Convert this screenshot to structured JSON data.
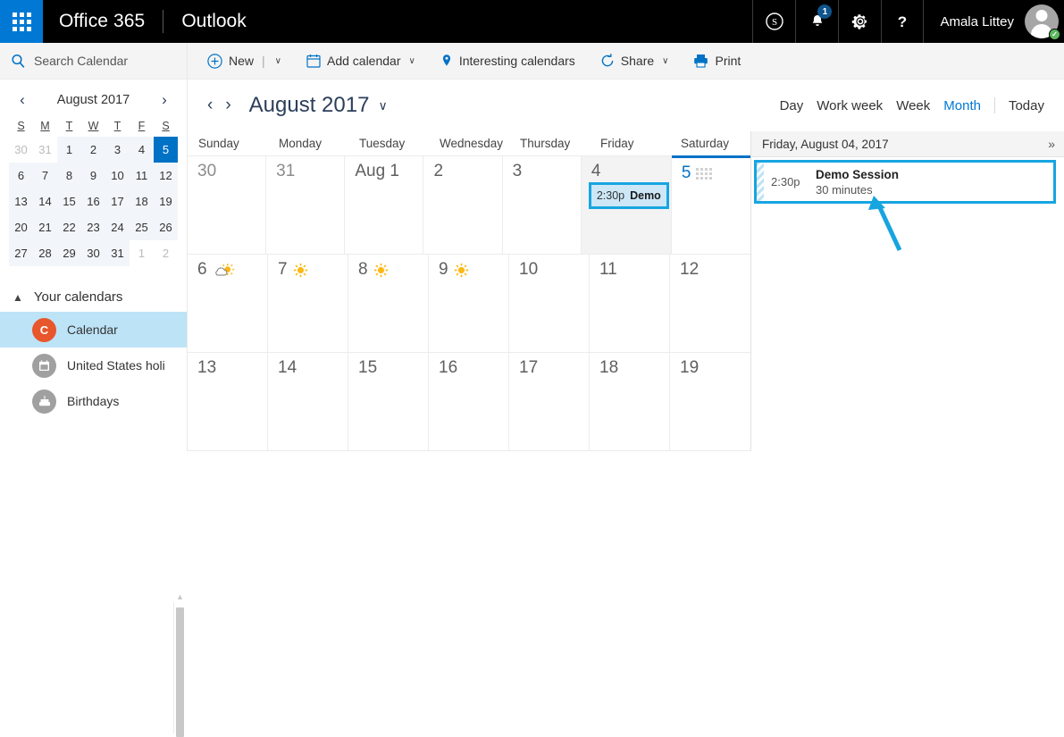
{
  "suite": {
    "waffle_name": "app-launcher",
    "brand": "Office 365",
    "app": "Outlook",
    "skype_icon": "skype-icon",
    "notifications_icon": "bell-icon",
    "notifications_count": "1",
    "settings_icon": "gear-icon",
    "help_icon": "help-icon",
    "user_name": "Amala Littey",
    "presence_icon": "available-check-icon"
  },
  "toolbar": {
    "new_label": "New",
    "new_split": "|",
    "add_calendar_label": "Add calendar",
    "interesting_label": "Interesting calendars",
    "share_label": "Share",
    "print_label": "Print",
    "caret": "∨"
  },
  "search": {
    "placeholder": "Search Calendar",
    "value": "",
    "icon": "search-icon"
  },
  "minicalendar": {
    "title": "August 2017",
    "prev": "‹",
    "next": "›",
    "dow": [
      "S",
      "M",
      "T",
      "W",
      "T",
      "F",
      "S"
    ],
    "weeks": [
      [
        {
          "d": "30",
          "m": "other"
        },
        {
          "d": "31",
          "m": "other"
        },
        {
          "d": "1",
          "m": "cur"
        },
        {
          "d": "2",
          "m": "cur"
        },
        {
          "d": "3",
          "m": "cur"
        },
        {
          "d": "4",
          "m": "cur"
        },
        {
          "d": "5",
          "m": "today"
        }
      ],
      [
        {
          "d": "6",
          "m": "cur"
        },
        {
          "d": "7",
          "m": "cur"
        },
        {
          "d": "8",
          "m": "cur"
        },
        {
          "d": "9",
          "m": "cur"
        },
        {
          "d": "10",
          "m": "cur"
        },
        {
          "d": "11",
          "m": "cur"
        },
        {
          "d": "12",
          "m": "cur"
        }
      ],
      [
        {
          "d": "13",
          "m": "cur"
        },
        {
          "d": "14",
          "m": "cur"
        },
        {
          "d": "15",
          "m": "cur"
        },
        {
          "d": "16",
          "m": "cur"
        },
        {
          "d": "17",
          "m": "cur"
        },
        {
          "d": "18",
          "m": "cur"
        },
        {
          "d": "19",
          "m": "cur"
        }
      ],
      [
        {
          "d": "20",
          "m": "cur"
        },
        {
          "d": "21",
          "m": "cur"
        },
        {
          "d": "22",
          "m": "cur"
        },
        {
          "d": "23",
          "m": "cur"
        },
        {
          "d": "24",
          "m": "cur"
        },
        {
          "d": "25",
          "m": "cur"
        },
        {
          "d": "26",
          "m": "cur"
        }
      ],
      [
        {
          "d": "27",
          "m": "cur"
        },
        {
          "d": "28",
          "m": "cur"
        },
        {
          "d": "29",
          "m": "cur"
        },
        {
          "d": "30",
          "m": "cur"
        },
        {
          "d": "31",
          "m": "cur"
        },
        {
          "d": "1",
          "m": "other"
        },
        {
          "d": "2",
          "m": "other"
        }
      ]
    ]
  },
  "calendars": {
    "section_label": "Your calendars",
    "collapse_icon": "chevron-up-icon",
    "items": [
      {
        "label": "Calendar",
        "glyph": "C",
        "color": "#e8562b",
        "icon": "calendar-letter-icon",
        "selected": true
      },
      {
        "label": "United States holi",
        "glyph": "",
        "color": "#a0a0a0",
        "icon": "holiday-calendar-icon",
        "selected": false
      },
      {
        "label": "Birthdays",
        "glyph": "",
        "color": "#a0a0a0",
        "icon": "birthday-cake-icon",
        "selected": false
      }
    ]
  },
  "calnav": {
    "prev": "‹",
    "next": "›",
    "title": "August 2017",
    "caret": "∨",
    "views": [
      {
        "label": "Day",
        "active": false
      },
      {
        "label": "Work week",
        "active": false
      },
      {
        "label": "Week",
        "active": false
      },
      {
        "label": "Month",
        "active": true
      }
    ],
    "today_label": "Today"
  },
  "grid": {
    "dow": [
      "Sunday",
      "Monday",
      "Tuesday",
      "Wednesday",
      "Thursday",
      "Friday",
      "Saturday"
    ],
    "weeks": [
      [
        {
          "num": "30",
          "type": "other"
        },
        {
          "num": "31",
          "type": "other"
        },
        {
          "num": "Aug 1",
          "type": "cur"
        },
        {
          "num": "2",
          "type": "cur"
        },
        {
          "num": "3",
          "type": "cur"
        },
        {
          "num": "4",
          "type": "cur",
          "shaded": true,
          "events": [
            {
              "time": "2:30p",
              "title": "Demo",
              "selected": true
            }
          ]
        },
        {
          "num": "5",
          "type": "today",
          "weather": "dots"
        }
      ],
      [
        {
          "num": "6",
          "type": "cur",
          "weather": "partly-cloudy"
        },
        {
          "num": "7",
          "type": "cur",
          "weather": "sunny"
        },
        {
          "num": "8",
          "type": "cur",
          "weather": "sunny"
        },
        {
          "num": "9",
          "type": "cur",
          "weather": "sunny"
        },
        {
          "num": "10",
          "type": "cur"
        },
        {
          "num": "11",
          "type": "cur"
        },
        {
          "num": "12",
          "type": "cur"
        }
      ],
      [
        {
          "num": "13",
          "type": "cur"
        },
        {
          "num": "14",
          "type": "cur"
        },
        {
          "num": "15",
          "type": "cur"
        },
        {
          "num": "16",
          "type": "cur"
        },
        {
          "num": "17",
          "type": "cur"
        },
        {
          "num": "18",
          "type": "cur"
        },
        {
          "num": "19",
          "type": "cur"
        }
      ]
    ]
  },
  "agenda": {
    "date": "Friday, August 04, 2017",
    "expand_icon": "chevron-double-right-icon",
    "expand_glyph": "»",
    "items": [
      {
        "time": "2:30p",
        "title": "Demo Session",
        "duration": "30 minutes",
        "selected": true
      }
    ]
  },
  "colors": {
    "accent": "#0072c6",
    "selection": "#17a5e0",
    "event_fill": "#cde7f7",
    "calendar_orange": "#e8562b",
    "waffle_blue": "#0078d4"
  }
}
